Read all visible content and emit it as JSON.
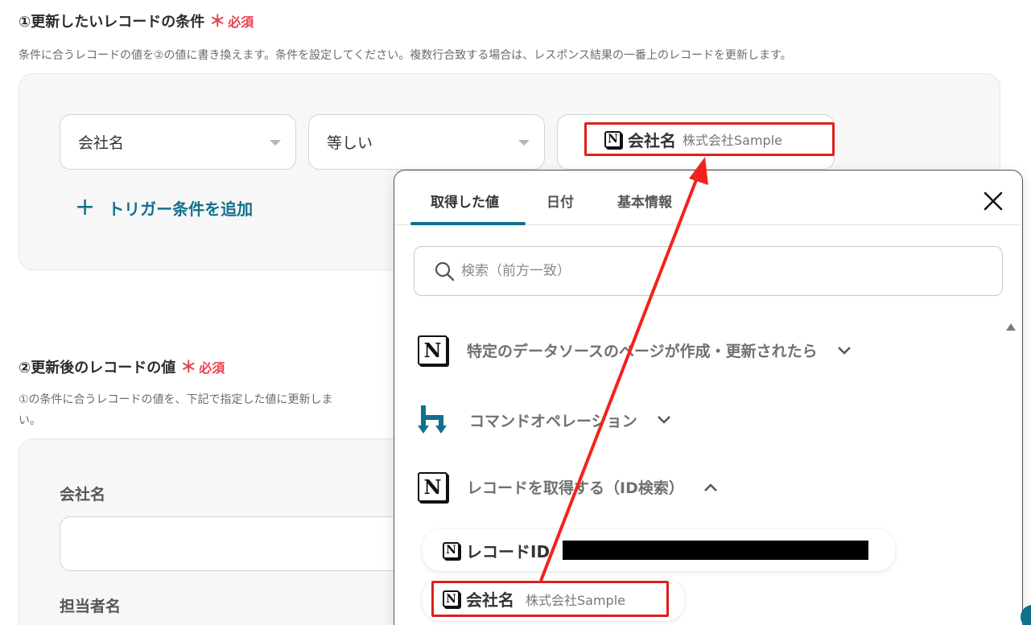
{
  "section1": {
    "title": "①更新したいレコードの条件",
    "required_mark": "＊",
    "required_text": "必須",
    "description": "条件に合うレコードの値を②の値に書き換えます。条件を設定してください。複数行合致する場合は、レスポンス結果の一番上のレコードを更新します。",
    "field_select": "会社名",
    "operator_select": "等しい",
    "value_chip": {
      "label": "会社名",
      "value": "株式会社Sample",
      "icon": "notion-icon"
    },
    "add_trigger": "トリガー条件を追加"
  },
  "section2": {
    "title": "②更新後のレコードの値",
    "required_mark": "＊",
    "required_text": "必須",
    "description_line1": "①の条件に合うレコードの値を、下記で指定した値に更新しま",
    "description_line2": "い。",
    "field1_label": "会社名",
    "field2_label": "担当者名"
  },
  "popup": {
    "tabs": [
      "取得した値",
      "日付",
      "基本情報"
    ],
    "active_tab": 0,
    "search_placeholder": "検索（前方一致）",
    "groups": [
      {
        "title": "特定のデータソースのページが作成・更新されたら",
        "icon": "notion-icon",
        "expanded": false
      },
      {
        "title": "コマンドオペレーション",
        "icon": "yoom-command-icon",
        "expanded": false
      },
      {
        "title": "レコードを取得する（ID検索）",
        "icon": "notion-icon",
        "expanded": true
      }
    ],
    "items": [
      {
        "label": "レコードID",
        "value_redacted": true
      },
      {
        "label": "会社名",
        "value": "株式会社Sample"
      }
    ]
  },
  "colors": {
    "accent": "#10718c",
    "required": "#e8434f",
    "highlight": "#e0201d",
    "arrow": "#f2231c"
  }
}
